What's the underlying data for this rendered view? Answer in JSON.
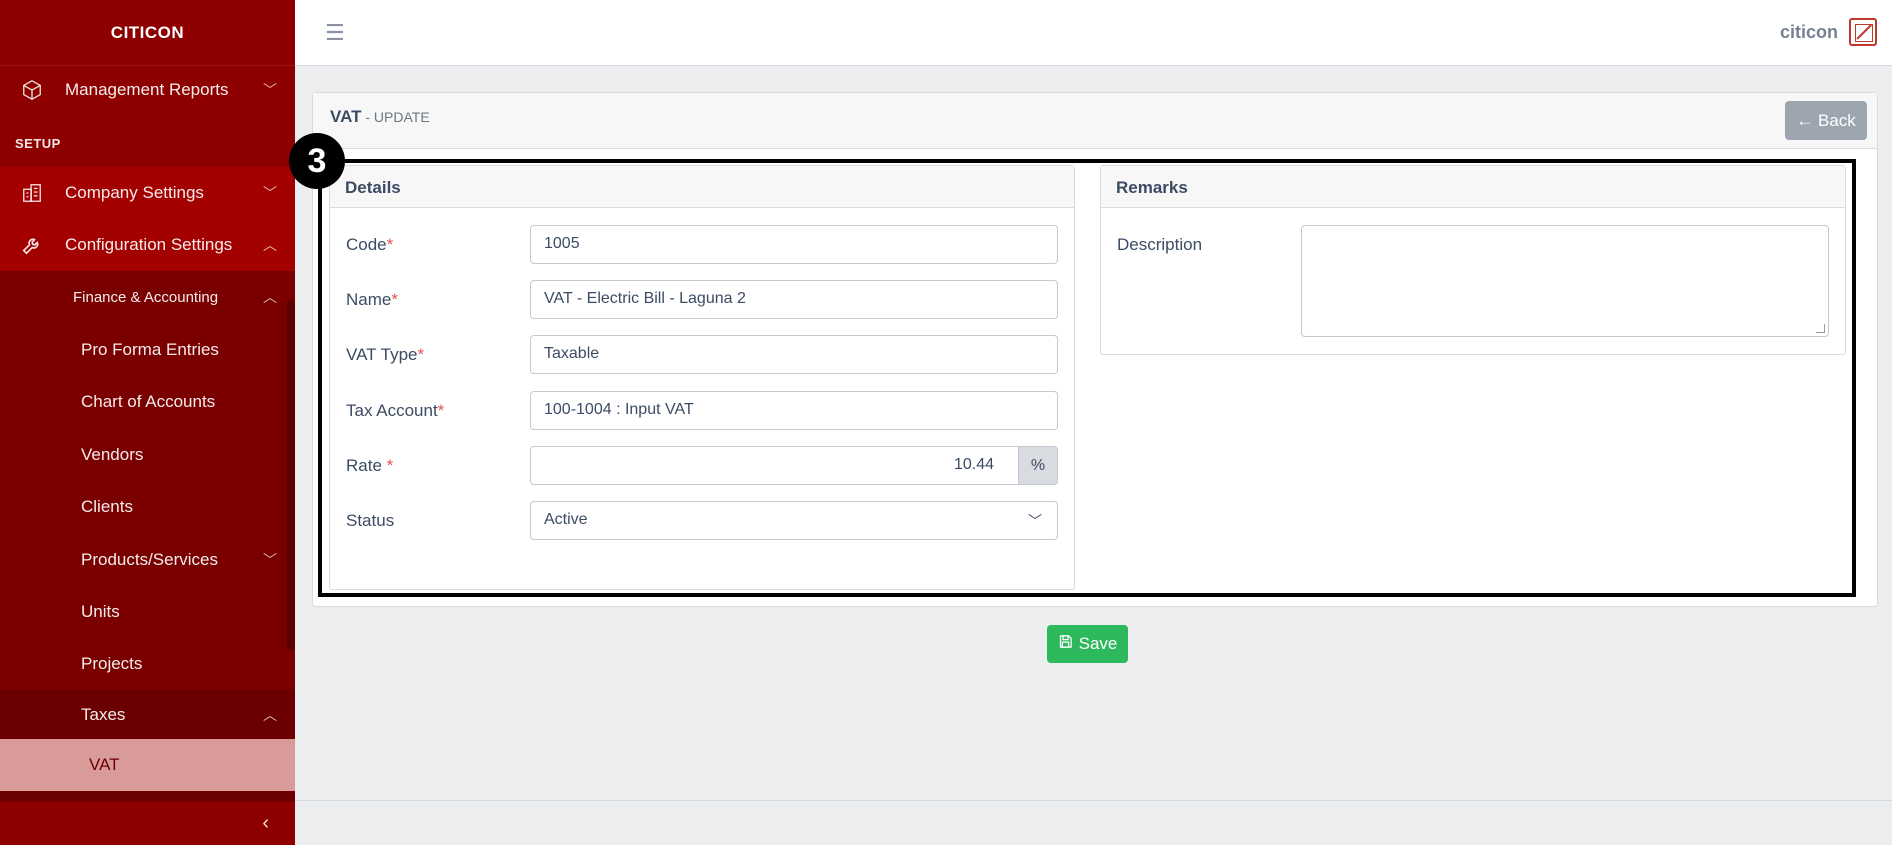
{
  "sidebar": {
    "brand": "CITICON",
    "management_reports": "Management Reports",
    "section_setup": "SETUP",
    "company_settings": "Company Settings",
    "configuration_settings": "Configuration Settings",
    "finance_accounting": "Finance & Accounting",
    "pro_forma_entries": "Pro Forma Entries",
    "chart_of_accounts": "Chart of Accounts",
    "vendors": "Vendors",
    "clients": "Clients",
    "products_services": "Products/Services",
    "units": "Units",
    "projects": "Projects",
    "taxes": "Taxes",
    "vat": "VAT",
    "collapse_icon": "chevron-left-icon"
  },
  "header": {
    "menu_icon": "hamburger-icon",
    "username": "citicon"
  },
  "page": {
    "title": "VAT",
    "subtitle": " - UPDATE",
    "back_label": "← Back",
    "annotation_number": "3"
  },
  "details": {
    "heading": "Details",
    "code_label": "Code",
    "code_value": "1005",
    "name_label": "Name",
    "name_value": "VAT - Electric Bill - Laguna 2",
    "vat_type_label": "VAT Type",
    "vat_type_value": "Taxable",
    "tax_account_label": "Tax Account",
    "tax_account_value": "100-1004 : Input VAT",
    "rate_label": "Rate ",
    "rate_value": "10.44",
    "rate_suffix": "%",
    "status_label": "Status",
    "status_value": "Active",
    "required_mark": "*"
  },
  "remarks": {
    "heading": "Remarks",
    "description_label": "Description",
    "description_value": ""
  },
  "actions": {
    "save_label": "Save"
  },
  "colors": {
    "sidebar": "#8e0000",
    "active_item": "#d99a9a",
    "save": "#2eb85c",
    "back": "#9da5b1"
  }
}
